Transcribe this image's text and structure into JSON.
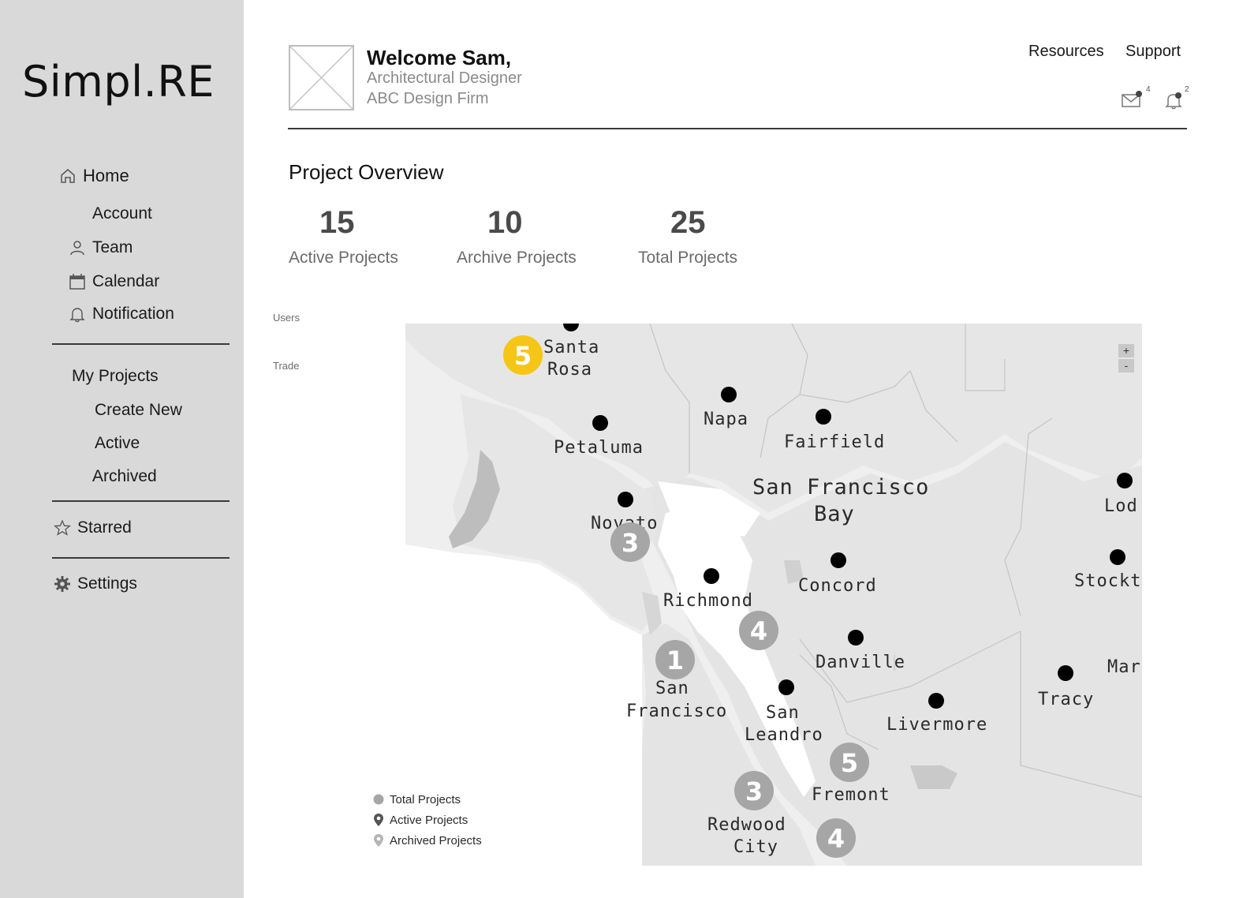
{
  "app": {
    "logo": "Simpl.RE"
  },
  "sidebar": {
    "home": "Home",
    "account": "Account",
    "team": "Team",
    "calendar": "Calendar",
    "notification": "Notification",
    "my_projects": "My Projects",
    "create_new": "Create New",
    "active": "Active",
    "archived": "Archived",
    "starred": "Starred",
    "settings": "Settings"
  },
  "header": {
    "welcome": "Welcome Sam,",
    "role": "Architectural Designer",
    "firm": "ABC Design Firm",
    "links": {
      "resources": "Resources",
      "support": "Support"
    },
    "mail_count": "4",
    "notification_count": "2"
  },
  "overview": {
    "title": "Project Overview",
    "stats": [
      {
        "value": "15",
        "label": "Active Projects"
      },
      {
        "value": "10",
        "label": "Archive Projects"
      },
      {
        "value": "25",
        "label": "Total Projects"
      }
    ],
    "side_labels": {
      "users": "Users",
      "trade": "Trade"
    }
  },
  "map": {
    "zoom_in": "+",
    "zoom_out": "-",
    "bay_label_line1": "San Francisco",
    "bay_label_line2": "Bay",
    "cities": {
      "santa_rosa_1": "Santa",
      "santa_rosa_2": "Rosa",
      "napa": "Napa",
      "fairfield": "Fairfield",
      "petaluma": "Petaluma",
      "novato": "Novato",
      "richmond": "Richmond",
      "concord": "Concord",
      "danville": "Danville",
      "san_francisco_1": "San",
      "san_francisco_2": "Francisco",
      "san_leandro_1": "San",
      "san_leandro_2": "Leandro",
      "livermore": "Livermore",
      "fremont": "Fremont",
      "redwood_city_1": "Redwood",
      "redwood_city_2": "City",
      "tracy": "Tracy",
      "lodi": "Lod",
      "stockton": "Stockt",
      "manteca": "Mar"
    },
    "clusters": {
      "santa_rosa": "5",
      "novato": "3",
      "walnut_creek": "4",
      "san_francisco": "1",
      "fremont": "5",
      "redwood_city": "3",
      "palo_alto": "4"
    },
    "colors": {
      "highlight": "#f5c518",
      "cluster": "#a6a6a6",
      "land": "#e4e4e4",
      "water": "#ffffff"
    }
  },
  "legend": {
    "total": "Total Projects",
    "active": "Active Projects",
    "archived": "Archived Projects"
  }
}
